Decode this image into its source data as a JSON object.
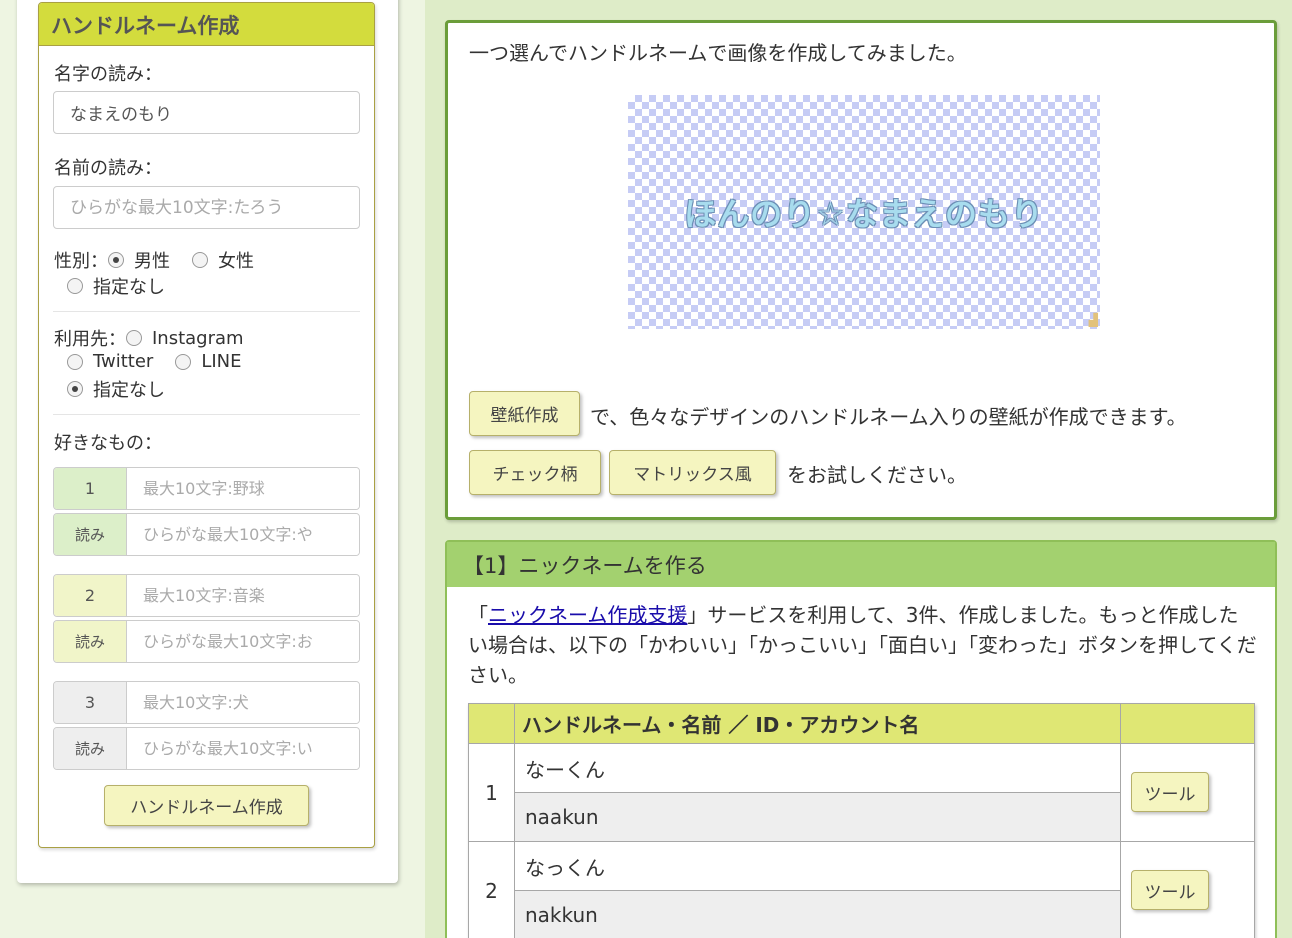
{
  "form": {
    "title": "ハンドルネーム作成",
    "surname_label": "名字の読み：",
    "surname_value": "なまえのもり",
    "name_label": "名前の読み：",
    "name_placeholder": "ひらがな最大10文字:たろう",
    "gender_label": "性別：",
    "gender_options": [
      "男性",
      "女性",
      "指定なし"
    ],
    "gender_selected": "男性",
    "usage_label": "利用先：",
    "usage_options": [
      "Instagram",
      "Twitter",
      "LINE",
      "指定なし"
    ],
    "usage_selected": "指定なし",
    "likes_label": "好きなもの：",
    "likes": [
      {
        "index": "1",
        "placeholder": "最大10文字:野球",
        "yomi_label": "読み",
        "yomi_placeholder": "ひらがな最大10文字:や"
      },
      {
        "index": "2",
        "placeholder": "最大10文字:音楽",
        "yomi_label": "読み",
        "yomi_placeholder": "ひらがな最大10文字:お"
      },
      {
        "index": "3",
        "placeholder": "最大10文字:犬",
        "yomi_label": "読み",
        "yomi_placeholder": "ひらがな最大10文字:い"
      }
    ],
    "submit_label": "ハンドルネーム作成"
  },
  "intro": {
    "text": "一つ選んでハンドルネームで画像を作成してみました。",
    "preview_text": "ほんのり☆なまえのもり",
    "wallpaper_button": "壁紙作成",
    "wallpaper_text": "で、色々なデザインのハンドルネーム入りの壁紙が作成できます。",
    "check_button": "チェック柄",
    "matrix_button": "マトリックス風",
    "try_text": "をお試しください。"
  },
  "section": {
    "heading": "【1】ニックネームを作る",
    "desc_prefix": "「",
    "desc_link": "ニックネーム作成支援",
    "desc_suffix": "」サービスを利用して、3件、作成しました。もっと作成したい場合は、以下の「かわいい」「かっこいい」「面白い」「変わった」ボタンを押してください。",
    "table_header": "ハンドルネーム・名前 ／ ID・アカウント名",
    "rows": [
      {
        "num": "1",
        "name": "なーくん",
        "romaji": "naakun",
        "tool": "ツール"
      },
      {
        "num": "2",
        "name": "なっくん",
        "romaji": "nakkun",
        "tool": "ツール"
      }
    ]
  },
  "colors": {
    "accent_yellow": "#d3dc3d",
    "accent_green": "#a3d16f",
    "border_green": "#6b9d3a"
  }
}
